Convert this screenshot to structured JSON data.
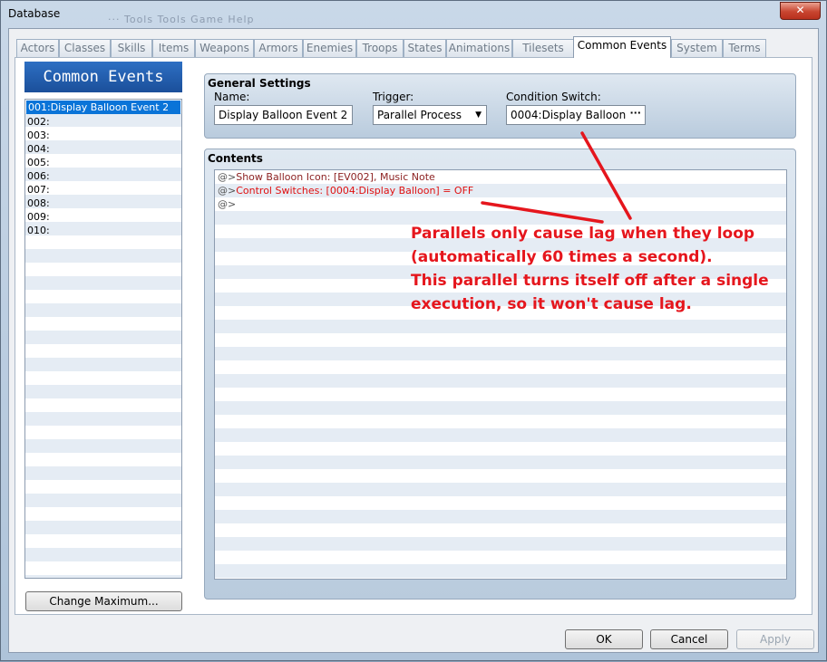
{
  "window": {
    "title": "Database",
    "close_glyph": "✕",
    "ghost_menu": "··· Tools  Tools  Game  Help"
  },
  "tabs": [
    {
      "label": "Actors"
    },
    {
      "label": "Classes"
    },
    {
      "label": "Skills"
    },
    {
      "label": "Items"
    },
    {
      "label": "Weapons"
    },
    {
      "label": "Armors"
    },
    {
      "label": "Enemies"
    },
    {
      "label": "Troops"
    },
    {
      "label": "States"
    },
    {
      "label": "Animations"
    },
    {
      "label": "Tilesets"
    },
    {
      "label": "Common Events"
    },
    {
      "label": "System"
    },
    {
      "label": "Terms"
    }
  ],
  "active_tab": "Common Events",
  "left_panel": {
    "header": "Common Events",
    "events": [
      {
        "label": "001:Display Balloon Event 2"
      },
      {
        "label": "002:"
      },
      {
        "label": "003:"
      },
      {
        "label": "004:"
      },
      {
        "label": "005:"
      },
      {
        "label": "006:"
      },
      {
        "label": "007:"
      },
      {
        "label": "008:"
      },
      {
        "label": "009:"
      },
      {
        "label": "010:"
      }
    ],
    "selected_index": 0,
    "change_max_label": "Change Maximum..."
  },
  "general": {
    "title": "General Settings",
    "name_label": "Name:",
    "name_value": "Display Balloon Event 2",
    "trigger_label": "Trigger:",
    "trigger_value": "Parallel Process",
    "trigger_arrow": "▼",
    "switch_label": "Condition Switch:",
    "switch_value": "0004:Display Balloon",
    "switch_button": "···"
  },
  "contents": {
    "title": "Contents",
    "commands": [
      {
        "prefix": "@>",
        "text": "Show Balloon Icon: [EV002], Music Note",
        "style": "brown"
      },
      {
        "prefix": "@>",
        "text": "Control Switches: [0004:Display Balloon] = OFF",
        "style": "red"
      },
      {
        "prefix": "@>",
        "text": "",
        "style": "plain"
      }
    ]
  },
  "annotation": {
    "lines": [
      "Parallels only cause lag when they loop",
      "(automatically 60 times a second).",
      "This parallel turns itself off after a single",
      "execution, so it won't cause lag."
    ],
    "color": "#e5161d"
  },
  "footer": {
    "ok_label": "OK",
    "cancel_label": "Cancel",
    "apply_label": "Apply"
  }
}
